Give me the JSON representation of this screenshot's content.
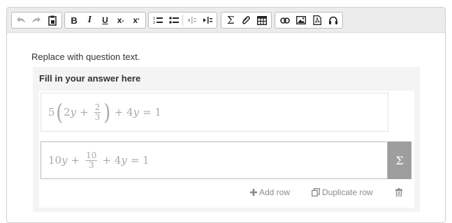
{
  "toolbar": {
    "groups": [
      [
        "undo-icon",
        "redo-icon",
        "paste-icon"
      ],
      [
        "bold",
        "italic",
        "underline",
        "subscript",
        "superscript"
      ],
      [
        "numbered-list-icon",
        "bullet-list-icon",
        "outdent-icon",
        "indent-icon"
      ],
      [
        "sigma-icon",
        "paperclip-icon",
        "table-icon"
      ],
      [
        "link-icon",
        "image-icon",
        "pdf-icon",
        "audio-icon"
      ]
    ],
    "bold_label": "B",
    "italic_label": "I",
    "underline_label": "U",
    "subscript_label": "x",
    "subscript_small": "₂",
    "superscript_label": "x",
    "superscript_small": "²",
    "sigma_label": "Σ"
  },
  "question": {
    "text": "Replace with question text."
  },
  "answer_panel": {
    "title": "Fill in your answer here",
    "row1": {
      "coef": "5",
      "term_a": "2",
      "var_a": "y",
      "plus": "+",
      "frac_num": "2",
      "frac_den": "3",
      "rest": "+ 4",
      "var_b": "y",
      "eq": "= 1"
    },
    "row2": {
      "coef": "10",
      "var_a": "y",
      "plus": "+",
      "frac_num": "10",
      "frac_den": "3",
      "rest": "+ 4",
      "var_b": "y",
      "eq": "= 1"
    },
    "math_button_label": "Σ",
    "add_row_label": "Add row",
    "duplicate_row_label": "Duplicate row"
  }
}
